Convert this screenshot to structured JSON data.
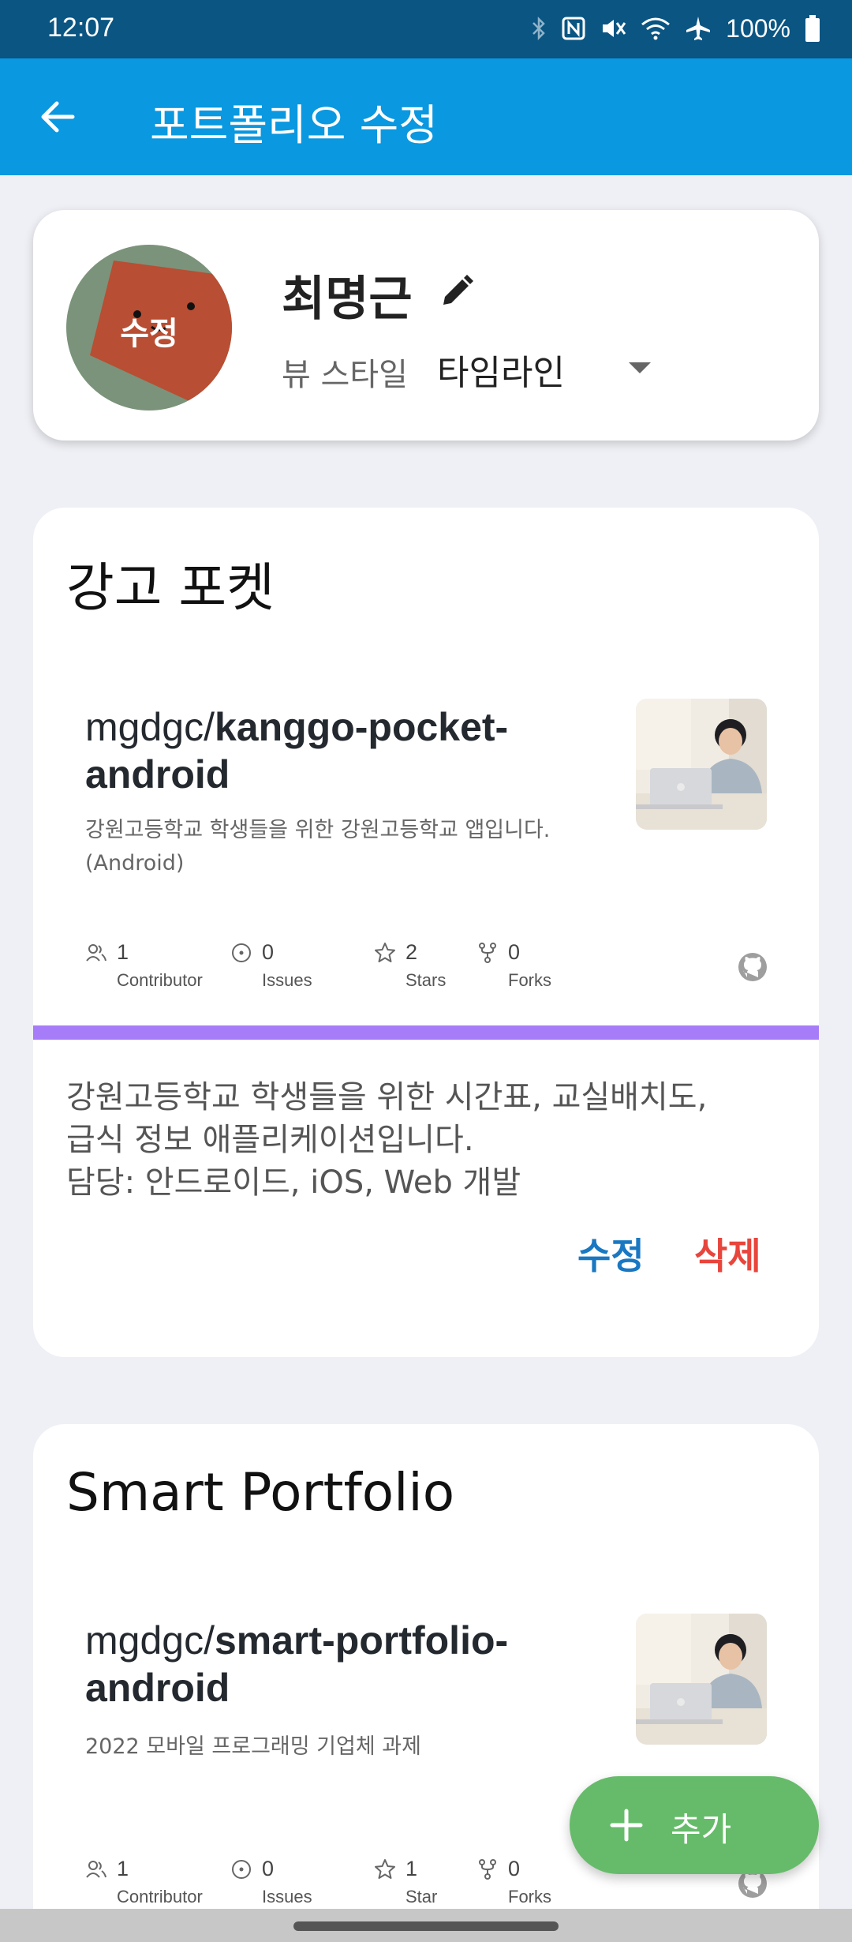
{
  "status_bar": {
    "time": "12:07",
    "battery": "100%",
    "icons": [
      "bluetooth-icon",
      "nfc-icon",
      "vibrate-icon",
      "wifi-icon",
      "airplane-icon",
      "battery-icon"
    ]
  },
  "app_bar": {
    "title": "포트폴리오 수정"
  },
  "profile": {
    "avatar_label": "수정",
    "name": "최명근",
    "view_style_label": "뷰 스타일",
    "view_style_value": "타임라인"
  },
  "cards": [
    {
      "heading": "강고 포켓",
      "repo_owner": "mgdgc/",
      "repo_name_line1": "kanggo-pocket-",
      "repo_name_line2": "android",
      "repo_desc_line1": "강원고등학교 학생들을 위한 강원고등학교 앱입니다.",
      "repo_desc_line2": "(Android)",
      "stats": [
        {
          "value": "1",
          "label": "Contributor",
          "icon": "people-icon"
        },
        {
          "value": "0",
          "label": "Issues",
          "icon": "issue-icon"
        },
        {
          "value": "2",
          "label": "Stars",
          "icon": "star-icon"
        },
        {
          "value": "0",
          "label": "Forks",
          "icon": "fork-icon"
        }
      ],
      "body_line1": "강원고등학교 학생들을 위한 시간표, 교실배치도,",
      "body_line2": "급식 정보 애플리케이션입니다.",
      "body_line3": "담당: 안드로이드, iOS, Web 개발",
      "edit_label": "수정",
      "delete_label": "삭제"
    },
    {
      "heading": "Smart Portfolio",
      "repo_owner": "mgdgc/",
      "repo_name_line1": "smart-portfolio-",
      "repo_name_line2": "android",
      "repo_desc_line1": "2022 모바일 프로그래밍 기업체 과제",
      "stats": [
        {
          "value": "1",
          "label": "Contributor",
          "icon": "people-icon"
        },
        {
          "value": "0",
          "label": "Issues",
          "icon": "issue-icon"
        },
        {
          "value": "1",
          "label": "Star",
          "icon": "star-icon"
        },
        {
          "value": "0",
          "label": "Forks",
          "icon": "fork-icon"
        }
      ]
    }
  ],
  "fab": {
    "label": "추가"
  },
  "colors": {
    "status_bar": "#0a5582",
    "app_bar": "#0a98e0",
    "stripe": "#a77cf8",
    "edit": "#1a78c2",
    "delete": "#e8453c",
    "fab": "#66bb6a"
  }
}
